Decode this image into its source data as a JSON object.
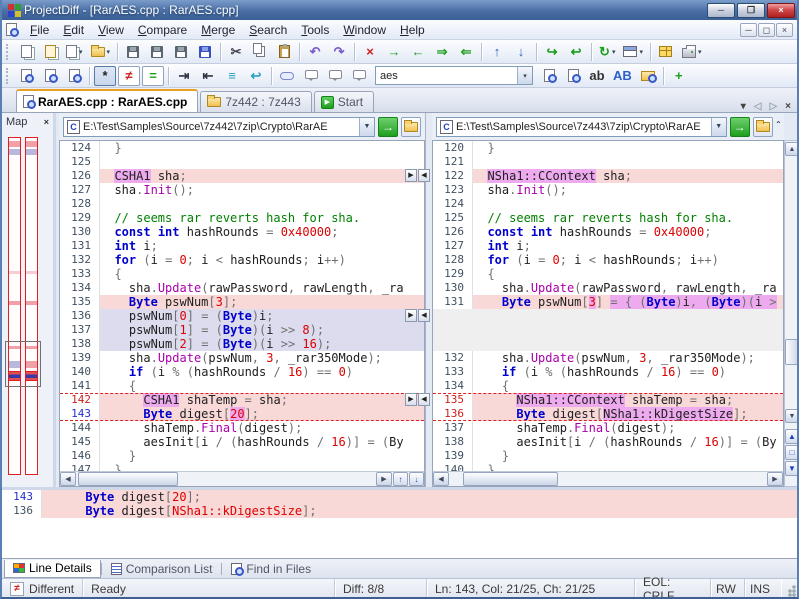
{
  "window": {
    "title": "ProjectDiff - [RarAES.cpp : RarAES.cpp]"
  },
  "menu": {
    "items": [
      "File",
      "Edit",
      "View",
      "Compare",
      "Merge",
      "Search",
      "Tools",
      "Window",
      "Help"
    ]
  },
  "toolbars": {
    "search_value": "aes",
    "row1": [
      {
        "name": "new-file-comparison-button",
        "k": "doc2"
      },
      {
        "name": "new-folder-comparison-button",
        "k": "doc2b"
      },
      {
        "name": "new-comparison-dropdown",
        "k": "doc2",
        "dd": 1
      },
      {
        "name": "open-button",
        "k": "folder",
        "dd": 1
      },
      {
        "sep": 1
      },
      {
        "name": "save-left-button",
        "k": "floppy"
      },
      {
        "name": "save-right-button",
        "k": "floppy"
      },
      {
        "name": "save-both-button",
        "k": "floppy"
      },
      {
        "name": "save-all-button",
        "k": "floppyb"
      },
      {
        "sep": 1
      },
      {
        "name": "cut-button",
        "g": "✂",
        "c": "#445"
      },
      {
        "name": "copy-button",
        "k": "copy"
      },
      {
        "name": "paste-button",
        "k": "paste"
      },
      {
        "sep": 1
      },
      {
        "name": "undo-button",
        "g": "↶",
        "c": "#7a5ccc"
      },
      {
        "name": "redo-button",
        "g": "↷",
        "c": "#7a5ccc"
      },
      {
        "sep": 1
      },
      {
        "name": "cancel-comparison-button",
        "g": "×",
        "c": "#d02020"
      },
      {
        "name": "next-difference-button",
        "g": "→",
        "c": "#1e9e1e"
      },
      {
        "name": "previous-difference-button",
        "g": "←",
        "c": "#1e9e1e"
      },
      {
        "name": "next-difference-file-button",
        "g": "⇒",
        "c": "#1e9e1e"
      },
      {
        "name": "previous-difference-file-button",
        "g": "⇐",
        "c": "#1e9e1e"
      },
      {
        "sep": 1
      },
      {
        "name": "move-up-button",
        "g": "↑",
        "c": "#2b5fd0"
      },
      {
        "name": "move-down-button",
        "g": "↓",
        "c": "#2b5fd0"
      },
      {
        "sep": 1
      },
      {
        "name": "copy-to-right-button",
        "g": "↪",
        "c": "#1e9e1e"
      },
      {
        "name": "copy-to-left-button",
        "g": "↩",
        "c": "#1e9e1e"
      },
      {
        "sep": 1
      },
      {
        "name": "recompare-button",
        "g": "↻",
        "c": "#1e9e1e",
        "dd": 1
      },
      {
        "name": "view-mode-button",
        "k": "win",
        "dd": 1
      },
      {
        "sep": 1
      },
      {
        "name": "report-button",
        "k": "table"
      },
      {
        "name": "print-button",
        "k": "printer",
        "dd": 1
      }
    ],
    "row2": [
      {
        "name": "open-left-file-button",
        "k": "docmag"
      },
      {
        "name": "open-right-file-button",
        "k": "docmag"
      },
      {
        "name": "view-file-button",
        "k": "docmag"
      },
      {
        "sep": 1
      },
      {
        "name": "show-all-button",
        "g": "*",
        "c": "#222",
        "pressed": 1
      },
      {
        "name": "show-differences-button",
        "g": "≠",
        "c": "#d02020",
        "frame": 1
      },
      {
        "name": "show-matches-button",
        "g": "=",
        "c": "#1e9e1e",
        "frame": 1
      },
      {
        "sep": 1
      },
      {
        "name": "ignore-indent-button",
        "g": "⇥",
        "c": "#334"
      },
      {
        "name": "ignore-whitespace-button",
        "g": "⇤",
        "c": "#334"
      },
      {
        "name": "ignore-blank-lines-button",
        "g": "≡",
        "c": "#2aa0c0"
      },
      {
        "name": "word-wrap-button",
        "g": "↩",
        "c": "#2aa0c0"
      },
      {
        "sep": 1
      },
      {
        "name": "bookmark-button",
        "k": "pill"
      },
      {
        "name": "add-comment-button",
        "k": "bubble"
      },
      {
        "name": "next-comment-button",
        "k": "bubble"
      },
      {
        "name": "find-comment-button",
        "k": "bubble"
      },
      {
        "combo": 1
      },
      {
        "name": "find-next-button",
        "k": "docmag"
      },
      {
        "name": "find-previous-button",
        "k": "docmag"
      },
      {
        "name": "replace-button",
        "g": "ab",
        "c": "#333"
      },
      {
        "name": "match-case-button",
        "g": "AB",
        "c": "#2b5fd0"
      },
      {
        "name": "find-in-files-button",
        "k": "foldermag"
      },
      {
        "sep": 1
      },
      {
        "name": "sync-scrolling-button",
        "g": "+",
        "c": "#1e9e1e"
      }
    ]
  },
  "tab_strip": {
    "tabs": [
      {
        "label": "RarAES.cpp : RarAES.cpp",
        "icon": "file-compare-icon",
        "k": "docmag",
        "active": true
      },
      {
        "label": "7z442 : 7z443",
        "icon": "folder-compare-icon",
        "k": "folder",
        "active": false
      },
      {
        "label": "Start",
        "icon": "start-page-icon",
        "k": "start",
        "active": false
      }
    ],
    "controls": [
      {
        "name": "tab-list-dropdown",
        "g": "▾"
      },
      {
        "name": "scroll-tabs-left-button",
        "g": "◁",
        "dim": 1
      },
      {
        "name": "scroll-tabs-right-button",
        "g": "▷",
        "dim": 1
      },
      {
        "name": "close-document-button",
        "g": "×"
      }
    ]
  },
  "map": {
    "title": "Map",
    "viewport": {
      "top": 60.5,
      "h": 13.5
    },
    "marks": [
      {
        "t": 0.8,
        "h": 1.8,
        "c": "pink",
        "col": "both"
      },
      {
        "t": 3.2,
        "h": 1.8,
        "c": "lav",
        "col": "both"
      },
      {
        "t": 39.5,
        "h": 1.0,
        "c": "pinkf",
        "col": "both"
      },
      {
        "t": 48.5,
        "h": 1.3,
        "c": "pink",
        "col": "both"
      },
      {
        "t": 61.8,
        "h": 1.0,
        "c": "pink",
        "col": "both"
      },
      {
        "t": 66.5,
        "h": 2.0,
        "c": "lav",
        "col": "left"
      },
      {
        "t": 66.5,
        "h": 2.0,
        "c": "pink",
        "col": "right"
      },
      {
        "t": 69.5,
        "h": 2.6,
        "c": "cur",
        "col": "both"
      }
    ]
  },
  "panes": {
    "left": {
      "path": "E:\\Test\\Samples\\Source\\7z442\\7zip\\Crypto\\RarAE",
      "lines": [
        {
          "n": 124,
          "t": "  }"
        },
        {
          "n": 125,
          "t": ""
        },
        {
          "n": 126,
          "t": "  CSHA1 sha;",
          "bg": "pink",
          "marks": [
            "CSHA1"
          ]
        },
        {
          "n": 127,
          "t": "  sha.Init();"
        },
        {
          "n": 128,
          "t": ""
        },
        {
          "n": 129,
          "t": "  // seems rar reverts hash for sha."
        },
        {
          "n": 130,
          "t": "  const int hashRounds = 0x40000;"
        },
        {
          "n": 131,
          "t": "  int i;"
        },
        {
          "n": 132,
          "t": "  for (i = 0; i < hashRounds; i++)"
        },
        {
          "n": 133,
          "t": "  {"
        },
        {
          "n": 134,
          "t": "    sha.Update(rawPassword, rawLength, _ra"
        },
        {
          "n": 135,
          "t": "    Byte pswNum[3];",
          "bg": "pink"
        },
        {
          "n": 136,
          "t": "    pswNum[0] = (Byte)i;",
          "bg": "lav"
        },
        {
          "n": 137,
          "t": "    pswNum[1] = (Byte)(i >> 8);",
          "bg": "lav"
        },
        {
          "n": 138,
          "t": "    pswNum[2] = (Byte)(i >> 16);",
          "bg": "lav"
        },
        {
          "n": 139,
          "t": "    sha.Update(pswNum, 3, _rar350Mode);"
        },
        {
          "n": 140,
          "t": "    if (i % (hashRounds / 16) == 0)"
        },
        {
          "n": 141,
          "t": "    {"
        },
        {
          "n": 142,
          "t": "      CSHA1 shaTemp = sha;",
          "bg": "pink",
          "numc": "red",
          "dash": "top",
          "marks": [
            "CSHA1"
          ]
        },
        {
          "n": 143,
          "t": "      Byte digest[20];",
          "bg": "pink",
          "numc": "blue",
          "dash": "bottom",
          "marks": [
            "20"
          ]
        },
        {
          "n": 144,
          "t": "      shaTemp.Final(digest);"
        },
        {
          "n": 145,
          "t": "      aesInit[i / (hashRounds / 16)] = (By"
        },
        {
          "n": 146,
          "t": "    }"
        },
        {
          "n": 147,
          "t": "  }"
        }
      ]
    },
    "right": {
      "path": "E:\\Test\\Samples\\Source\\7z443\\7zip\\Crypto\\RarAE",
      "lines": [
        {
          "n": 120,
          "t": "  }"
        },
        {
          "n": 121,
          "t": ""
        },
        {
          "n": 122,
          "t": "  NSha1::CContext sha;",
          "bg": "pink",
          "marks": [
            "NSha1::CContext"
          ]
        },
        {
          "n": 123,
          "t": "  sha.Init();"
        },
        {
          "n": 124,
          "t": ""
        },
        {
          "n": 125,
          "t": "  // seems rar reverts hash for sha."
        },
        {
          "n": 126,
          "t": "  const int hashRounds = 0x40000;"
        },
        {
          "n": 127,
          "t": "  int i;"
        },
        {
          "n": 128,
          "t": "  for (i = 0; i < hashRounds; i++)"
        },
        {
          "n": 129,
          "t": "  {"
        },
        {
          "n": 130,
          "t": "    sha.Update(rawPassword, rawLength, _ra"
        },
        {
          "n": 131,
          "t": "    Byte pswNum[3] = { (Byte)i, (Byte)(i >",
          "bg": "pink",
          "marks": [
            "3",
            "= { (Byte)i, (Byte)(i >"
          ]
        },
        {
          "gap": true
        },
        {
          "gap": true
        },
        {
          "gap": true
        },
        {
          "n": 132,
          "t": "    sha.Update(pswNum, 3, _rar350Mode);"
        },
        {
          "n": 133,
          "t": "    if (i % (hashRounds / 16) == 0)"
        },
        {
          "n": 134,
          "t": "    {"
        },
        {
          "n": 135,
          "t": "      NSha1::CContext shaTemp = sha;",
          "bg": "pink",
          "numc": "red",
          "dash": "top",
          "marks": [
            "NSha1::CContext"
          ]
        },
        {
          "n": 136,
          "t": "      Byte digest[NSha1::kDigestSize];",
          "bg": "pink",
          "numc": "red",
          "dash": "bottom",
          "marks": [
            "NSha1::kDigestSize"
          ]
        },
        {
          "n": 137,
          "t": "      shaTemp.Final(digest);"
        },
        {
          "n": 138,
          "t": "      aesInit[i / (hashRounds / 16)] = (By"
        },
        {
          "n": 139,
          "t": "    }"
        },
        {
          "n": 140,
          "t": "  }"
        }
      ]
    }
  },
  "gutter": {
    "merge_rows": [
      2,
      12,
      18
    ]
  },
  "details": {
    "lines": [
      {
        "n": "143",
        "t": "      Byte digest[20];",
        "red": [
          "20"
        ],
        "numc": "blue"
      },
      {
        "n": "136",
        "t": "      Byte digest[NSha1::kDigestSize];",
        "red": [
          "NSha1::kDigestSize"
        ],
        "numc": ""
      }
    ]
  },
  "bottom_tabs": [
    {
      "label": "Line Details",
      "icon": "line-details-icon",
      "k": "grid",
      "active": true
    },
    {
      "label": "Comparison List",
      "icon": "comparison-list-icon",
      "k": "list",
      "active": false
    },
    {
      "label": "Find in Files",
      "icon": "find-in-files-icon",
      "k": "findfiles",
      "active": false
    }
  ],
  "status": {
    "state": "Different",
    "message": "Ready",
    "diff": "Diff: 8/8",
    "caret": "Ln: 143, Col: 21/25, Ch: 21/25",
    "eol": "EOL: CRLF",
    "mode": "RW",
    "ins": "INS"
  },
  "colors": {
    "diff_line_background": "#f9d8d8",
    "changed_word_background": "#eeaaee",
    "deleted_line_background": "#dcdcee",
    "current_diff_border": "#e03030"
  }
}
